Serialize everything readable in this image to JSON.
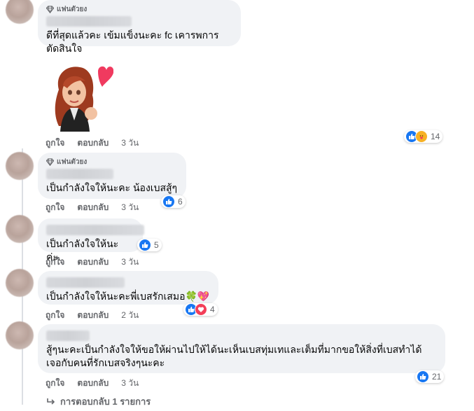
{
  "fan_badge_label": "แฟนตัวยง",
  "actions": {
    "like": "ถูกใจ",
    "reply": "ตอบกลับ"
  },
  "comments": [
    {
      "text": "ดีที่สุดแล้วคะ เข้มแข็งนะคะ fc เคารพการตัดสินใจ",
      "fan": true,
      "time": "3 วัน",
      "reaction_count": "14",
      "reactions": [
        "like",
        "care"
      ],
      "has_sticker": true
    },
    {
      "text": "เป็นกำลังใจให้นะคะ น้องเบสสู้ๆ",
      "fan": true,
      "time": "3 วัน",
      "reaction_count": "6",
      "reactions": [
        "like"
      ]
    },
    {
      "text": "เป็นกำลังใจให้นะค่ะ..",
      "fan": false,
      "time": "3 วัน",
      "reaction_count": "5",
      "reactions": [
        "like"
      ]
    },
    {
      "text": "เป็นกำลังใจให้นะคะพี่เบสรักเสมอ🍀💖",
      "fan": false,
      "time": "2 วัน",
      "reaction_count": "4",
      "reactions": [
        "like",
        "heart"
      ]
    },
    {
      "text_line1": "สู้ๆนะคะเป็นกำลังใจให้ขอให้ผ่านไปให้ได้นะเห็นเบสทุ่มเทและเต็มที่มากขอให้สิ่งที่เบสทำได้",
      "text_line2": "เจอกับคนที่รักเบสจริงๆนะคะ",
      "fan": false,
      "time": "3 วัน",
      "reaction_count": "21",
      "reactions": [
        "like"
      ]
    }
  ],
  "view_replies": "การตอบกลับ 1 รายการ",
  "colors": {
    "like": "#1877f2",
    "heart": "#f33e58",
    "care": "#f7b125",
    "bubble": "#f0f2f5",
    "meta": "#65676b"
  }
}
